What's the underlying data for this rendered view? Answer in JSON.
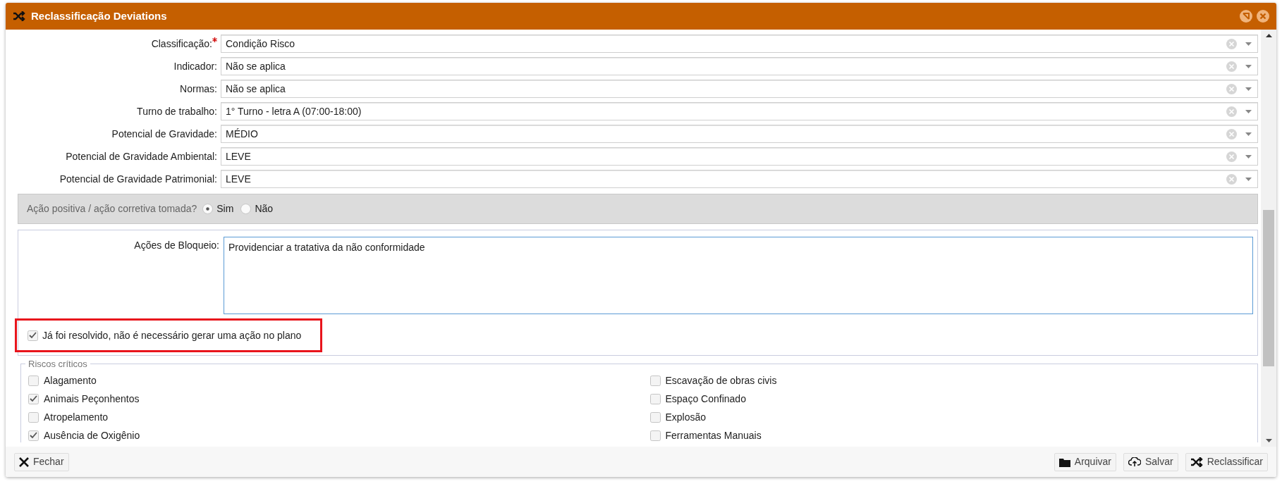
{
  "window": {
    "title": "Reclassificação Deviations"
  },
  "fields": [
    {
      "label": "Classificação:",
      "required": true,
      "value": "Condição Risco"
    },
    {
      "label": "Indicador:",
      "required": false,
      "value": "Não se aplica"
    },
    {
      "label": "Normas:",
      "required": false,
      "value": "Não se aplica"
    },
    {
      "label": "Turno de trabalho:",
      "required": false,
      "value": "1° Turno - letra A (07:00-18:00)"
    },
    {
      "label": "Potencial de Gravidade:",
      "required": false,
      "value": "MÉDIO"
    },
    {
      "label": "Potencial de Gravidade Ambiental:",
      "required": false,
      "value": "LEVE"
    },
    {
      "label": "Potencial de Gravidade Patrimonial:",
      "required": false,
      "value": "LEVE"
    }
  ],
  "corrective_action": {
    "question": "Ação positiva / ação corretiva tomada?",
    "options": [
      {
        "label": "Sim",
        "selected": true
      },
      {
        "label": "Não",
        "selected": false
      }
    ]
  },
  "blocking_actions": {
    "label": "Ações de Bloqueio:",
    "value": "Providenciar a tratativa da não conformidade"
  },
  "resolved": {
    "label": "Já foi resolvido, não é necessário gerar uma ação no plano",
    "checked": true,
    "highlighted": true
  },
  "critical_risks": {
    "legend": "Riscos críticos",
    "columns": [
      [
        {
          "label": "Alagamento",
          "checked": false
        },
        {
          "label": "Animais Peçonhentos",
          "checked": true
        },
        {
          "label": "Atropelamento",
          "checked": false
        },
        {
          "label": "Ausência de Oxigênio",
          "checked": true
        }
      ],
      [
        {
          "label": "Escavação de obras civis",
          "checked": false
        },
        {
          "label": "Espaço Confinado",
          "checked": false
        },
        {
          "label": "Explosão",
          "checked": false
        },
        {
          "label": "Ferramentas Manuais",
          "checked": false
        }
      ]
    ]
  },
  "footer": {
    "left_buttons": [
      "Fechar"
    ],
    "right_buttons": [
      "Arquivar",
      "Salvar",
      "Reclassificar"
    ]
  }
}
